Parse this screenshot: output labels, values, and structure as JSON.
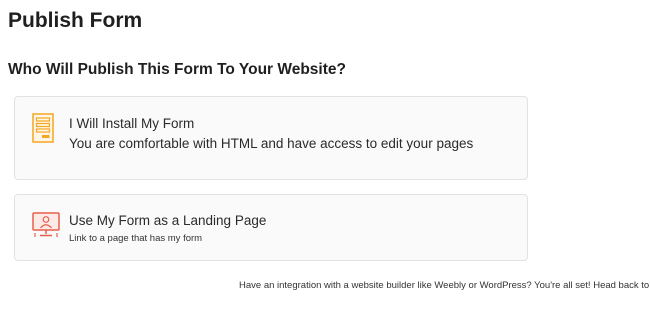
{
  "page_title": "Publish Form",
  "section_heading": "Who Will Publish This Form To Your Website?",
  "options": [
    {
      "title": "I Will Install My Form",
      "description": "You are comfortable with HTML and have access to edit your pages",
      "icon": "form-document-icon"
    },
    {
      "title": "Use My Form as a Landing Page",
      "description": "Link to a page that has my form",
      "icon": "monitor-user-icon"
    }
  ],
  "footer_note": "Have an integration with a website builder like Weebly or WordPress? You're all set! Head back to th",
  "colors": {
    "install_icon": "#f5a623",
    "landing_icon": "#e8604c",
    "card_background": "#fafafa",
    "card_border": "#e2e2e2"
  }
}
